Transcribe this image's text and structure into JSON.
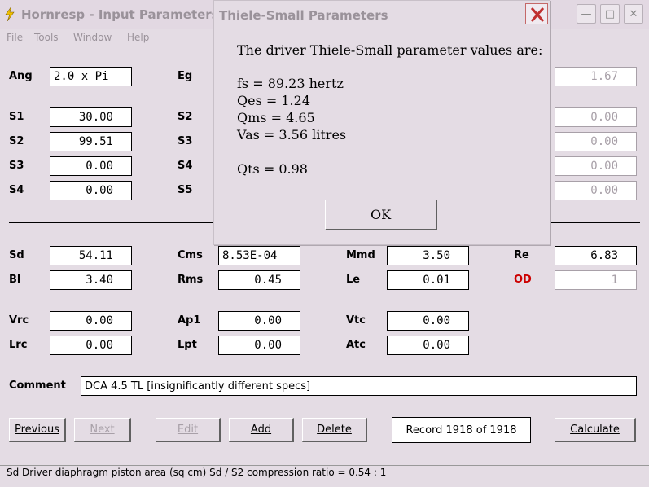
{
  "window": {
    "title": "Hornresp - Input Parameters"
  },
  "menu": [
    "File",
    "Tools",
    "Window",
    "Help"
  ],
  "fields": {
    "ang": {
      "label": "Ang",
      "value": "2.0 x Pi"
    },
    "eg": {
      "label": "Eg",
      "value": "1.67"
    },
    "s1": {
      "label": "S1",
      "value": "30.00"
    },
    "s2": {
      "label": "S2",
      "value": "99.51"
    },
    "s3": {
      "label": "S3",
      "value": "0.00"
    },
    "s4": {
      "label": "S4",
      "value": "0.00"
    },
    "s2b": {
      "label": "S2",
      "value": "0.00"
    },
    "s3b": {
      "label": "S3",
      "value": "0.00"
    },
    "s4b": {
      "label": "S4",
      "value": "0.00"
    },
    "s5": {
      "label": "S5",
      "value": "0.00"
    },
    "sd": {
      "label": "Sd",
      "value": "54.11"
    },
    "bl": {
      "label": "Bl",
      "value": "3.40"
    },
    "cms": {
      "label": "Cms",
      "value": "8.53E-04"
    },
    "rms": {
      "label": "Rms",
      "value": "0.45"
    },
    "mmd": {
      "label": "Mmd",
      "value": "3.50"
    },
    "le": {
      "label": "Le",
      "value": "0.01"
    },
    "re": {
      "label": "Re",
      "value": "6.83"
    },
    "od": {
      "label": "OD",
      "value": "1"
    },
    "vrc": {
      "label": "Vrc",
      "value": "0.00"
    },
    "lrc": {
      "label": "Lrc",
      "value": "0.00"
    },
    "ap1": {
      "label": "Ap1",
      "value": "0.00"
    },
    "lpt": {
      "label": "Lpt",
      "value": "0.00"
    },
    "vtc": {
      "label": "Vtc",
      "value": "0.00"
    },
    "atc": {
      "label": "Atc",
      "value": "0.00"
    }
  },
  "comment": {
    "label": "Comment",
    "value": "DCA 4.5 TL [insignificantly different specs]"
  },
  "buttons": {
    "previous": "Previous",
    "next": "Next",
    "edit": "Edit",
    "add": "Add",
    "delete": "Delete",
    "record": "Record 1918 of 1918",
    "calculate": "Calculate"
  },
  "status": "Sd   Driver diaphragm piston area  (sq cm)   Sd / S2 compression ratio = 0.54 : 1",
  "dialog": {
    "title": "Thiele-Small Parameters",
    "intro": "The driver Thiele-Small parameter values are:",
    "fs": "fs = 89.23 hertz",
    "qes": "Qes = 1.24",
    "qms": "Qms = 4.65",
    "vas": "Vas = 3.56 litres",
    "qts": "Qts = 0.98",
    "ok": "OK"
  },
  "colors": {
    "background": "#e4dce4",
    "od_label": "#cc0000",
    "disabled": "#a8a0a8"
  }
}
